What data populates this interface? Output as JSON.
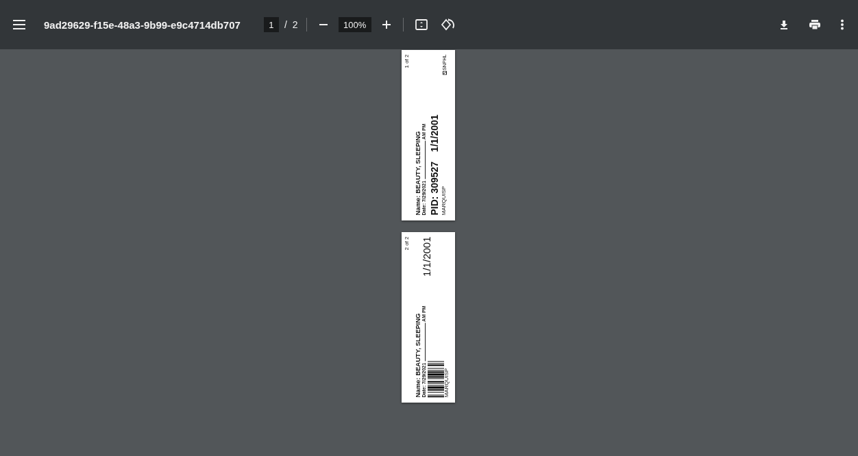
{
  "toolbar": {
    "title": "9ad29629-f15e-48a3-9b99-e9c4714db707",
    "page_value": "1",
    "page_separator": "/",
    "page_total": "2",
    "zoom_value": "100%"
  },
  "pages": [
    {
      "kind": "pid",
      "page_label": "1 of 2",
      "name": "Name: BEAUTY, SLEEPING",
      "date": "Date: 7/29/2021",
      "time": "AM PM",
      "pid": "PID: 309527",
      "dob": "1/1/2001",
      "user": "MARQUISP",
      "logo": "SNPHL"
    },
    {
      "kind": "barcode",
      "page_label": "2 of 2",
      "name": "Name: BEAUTY, SLEEPING",
      "date": "Date: 7/29/2021",
      "time": "AM PM",
      "dob": "1/1/2001",
      "user": "MARQUISP"
    }
  ]
}
